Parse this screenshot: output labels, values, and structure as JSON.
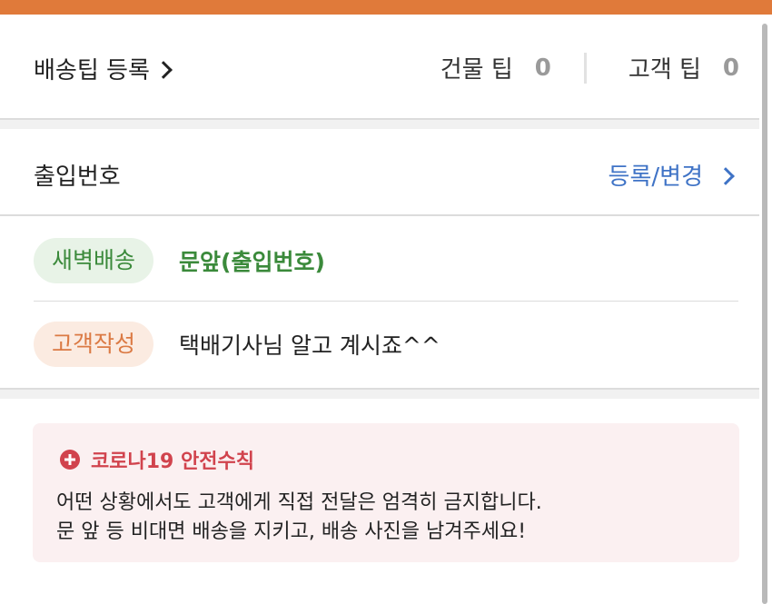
{
  "delivery_tip": {
    "register_label": "배송팁 등록",
    "building_tip_label": "건물 팁",
    "building_tip_value": "0",
    "customer_tip_label": "고객 팁",
    "customer_tip_value": "0"
  },
  "entrance": {
    "title": "출입번호",
    "action_label": "등록/변경"
  },
  "rows": [
    {
      "badge": "새벽배송",
      "text": "문앞(출입번호)"
    },
    {
      "badge": "고객작성",
      "text": "택배기사님 알고 계시죠^^"
    }
  ],
  "notice": {
    "title": "코로나19 안전수칙",
    "line1": "어떤 상황에서도 고객에게 직접 전달은 엄격히 금지합니다.",
    "line2": "문 앞 등 비대면 배송을 지키고, 배송 사진을 남겨주세요!"
  },
  "colors": {
    "top_bar": "#e07a3a",
    "link_blue": "#3f73c6",
    "green": "#3b8a3b",
    "orange": "#db7a44",
    "notice_red": "#d1434d"
  },
  "icons": {
    "register_chevron": "chevron-right-icon",
    "entrance_chevron": "chevron-right-icon",
    "notice_icon": "plus-circle-icon"
  }
}
